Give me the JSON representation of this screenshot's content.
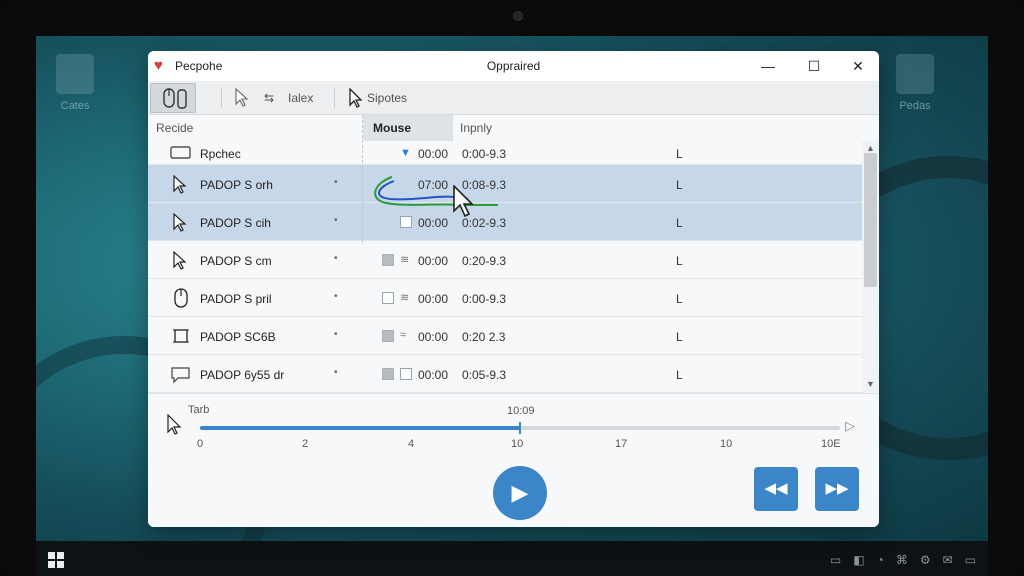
{
  "window": {
    "app_title": "Pecpohe",
    "center_title": "Oppraired",
    "minimize": "—",
    "maximize": "☐",
    "close": "✕"
  },
  "toolbar": {
    "item1": "Ialex",
    "item2": "Sipotes"
  },
  "columns": {
    "c1": "Recide",
    "c2": "Mouse",
    "c3": "Inpnly"
  },
  "rows": [
    {
      "name": "Rpchec",
      "tA": "00:00",
      "tB": "0:00-9.3",
      "L": "L",
      "icon": "window-icon",
      "sel": false
    },
    {
      "name": "PADOP S orh",
      "tA": "07:00",
      "tB": "0:08-9.3",
      "L": "L",
      "icon": "cursor-icon",
      "sel": true
    },
    {
      "name": "PADOP S cih",
      "tA": "00:00",
      "tB": "0:02-9.3",
      "L": "L",
      "icon": "cursor-icon",
      "sel": true
    },
    {
      "name": "PADOP S cm",
      "tA": "00:00",
      "tB": "0:20-9.3",
      "L": "L",
      "icon": "cursor-icon",
      "sel": false
    },
    {
      "name": "PADOP S pril",
      "tA": "00:00",
      "tB": "0:00-9.3",
      "L": "L",
      "icon": "mouse-icon",
      "sel": false
    },
    {
      "name": "PADOP SC6B",
      "tA": "00:00",
      "tB": "0:20 2.3",
      "L": "L",
      "icon": "frame-icon",
      "sel": false
    },
    {
      "name": "PADOP 6y55 dr",
      "tA": "00:00",
      "tB": "0:05-9.3",
      "L": "L",
      "icon": "chat-icon",
      "sel": false
    }
  ],
  "timeline": {
    "label": "Tarb",
    "current": "10:09",
    "ticks": [
      "0",
      "2",
      "4",
      "10",
      "17",
      "10",
      "10E"
    ],
    "progress": 0.5
  },
  "controls": {
    "play": "▶",
    "rewind": "◀◀",
    "forward": "▶▶"
  },
  "desktop": {
    "icon1": "Cates",
    "icon2": "Pedas"
  }
}
